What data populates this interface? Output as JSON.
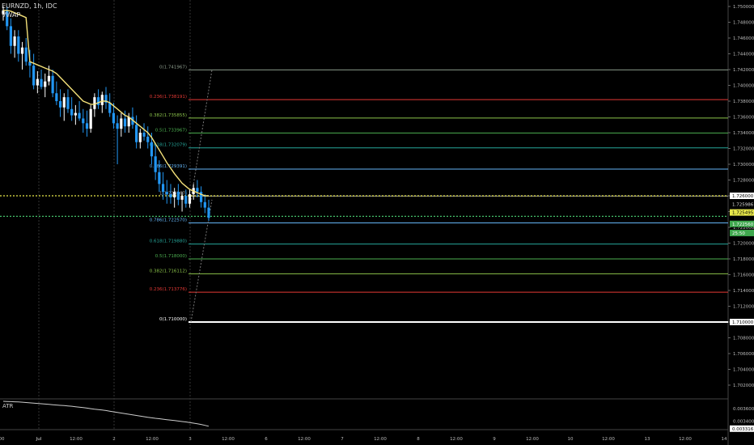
{
  "header": {
    "symbol": "EURNZD, 1h, IDC",
    "indicator": "VWAP"
  },
  "atr_label": "ATR",
  "colors": {
    "background": "#000000",
    "grid": "#2a2a2a",
    "candle_up": "#ffffff",
    "candle_down": "#2196f3",
    "vwap": "#f5e27a",
    "atr": "#cccccc",
    "price_dotted": "#e8e84a",
    "green_dotted": "#44c06a"
  },
  "price_axis": {
    "ticks": [
      "1.750000",
      "1.748000",
      "1.746000",
      "1.744000",
      "1.742000",
      "1.740000",
      "1.738000",
      "1.736000",
      "1.734000",
      "1.732000",
      "1.730000",
      "1.728000",
      "1.726000",
      "1.724000",
      "1.722000",
      "1.720000",
      "1.718000",
      "1.716000",
      "1.714000",
      "1.712000",
      "1.710000",
      "1.708000",
      "1.706000",
      "1.704000",
      "1.702000"
    ],
    "highlight_labels": [
      {
        "text": "1.726000",
        "kind": "white"
      },
      {
        "text": "1.725986",
        "kind": "black"
      },
      {
        "text": "1.725495",
        "kind": "yellow"
      },
      {
        "text": "1.722560",
        "kind": "green"
      },
      {
        "text": "25:50",
        "kind": "green"
      },
      {
        "text": "1.710000",
        "kind": "white"
      }
    ]
  },
  "atr_axis": {
    "ticks": [
      "0.003600",
      "0.003400"
    ],
    "current": "0.003316"
  },
  "time_axis": [
    "00",
    "Jul",
    "12:00",
    "2",
    "12:00",
    "3",
    "12:00",
    "6",
    "12:00",
    "7",
    "12:00",
    "8",
    "12:00",
    "9",
    "12:00",
    "10",
    "12:00",
    "13",
    "12:00",
    "14"
  ],
  "fib_upper": [
    {
      "label": "0(1.741967)",
      "price": 1.741967,
      "color": "#8a9a8a"
    },
    {
      "label": "0.236(1.738191)",
      "price": 1.738191,
      "color": "#e53935"
    },
    {
      "label": "0.382(1.735855)",
      "price": 1.735855,
      "color": "#8bc34a"
    },
    {
      "label": "0.5(1.733967)",
      "price": 1.733967,
      "color": "#4caf50"
    },
    {
      "label": "0.618(1.732079)",
      "price": 1.732079,
      "color": "#26a69a"
    },
    {
      "label": "0.786(1.729391)",
      "price": 1.729391,
      "color": "#64b5f6"
    },
    {
      "label": "1(1.725967)",
      "price": 1.725967,
      "color": "#9e9e9e"
    }
  ],
  "fib_lower": [
    {
      "label": "0.786(1.722570)",
      "price": 1.72257,
      "color": "#64b5f6"
    },
    {
      "label": "0.618(1.719880)",
      "price": 1.71988,
      "color": "#26a69a"
    },
    {
      "label": "0.5(1.718000)",
      "price": 1.718,
      "color": "#4caf50"
    },
    {
      "label": "0.382(1.716112)",
      "price": 1.716112,
      "color": "#8bc34a"
    },
    {
      "label": "0.236(1.713776)",
      "price": 1.713776,
      "color": "#e53935"
    },
    {
      "label": "0(1.710000)",
      "price": 1.71,
      "color": "#ffffff"
    }
  ],
  "candles": [
    [
      1.749,
      1.75,
      1.7482,
      1.7495
    ],
    [
      1.7495,
      1.75,
      1.747,
      1.7475
    ],
    [
      1.7475,
      1.7485,
      1.744,
      1.745
    ],
    [
      1.745,
      1.747,
      1.7435,
      1.7462
    ],
    [
      1.7462,
      1.747,
      1.743,
      1.744
    ],
    [
      1.744,
      1.7455,
      1.742,
      1.7448
    ],
    [
      1.7448,
      1.746,
      1.7425,
      1.743
    ],
    [
      1.743,
      1.7445,
      1.741,
      1.7425
    ],
    [
      1.7425,
      1.744,
      1.7395,
      1.74
    ],
    [
      1.74,
      1.7418,
      1.739,
      1.7408
    ],
    [
      1.7408,
      1.742,
      1.7395,
      1.7398
    ],
    [
      1.7398,
      1.7415,
      1.7385,
      1.7405
    ],
    [
      1.7405,
      1.7425,
      1.74,
      1.7412
    ],
    [
      1.7412,
      1.742,
      1.7385,
      1.739
    ],
    [
      1.739,
      1.7405,
      1.7375,
      1.738
    ],
    [
      1.738,
      1.7395,
      1.736,
      1.7372
    ],
    [
      1.7372,
      1.739,
      1.7355,
      1.7385
    ],
    [
      1.7385,
      1.7395,
      1.7365,
      1.737
    ],
    [
      1.737,
      1.7385,
      1.7355,
      1.7362
    ],
    [
      1.7362,
      1.7375,
      1.735,
      1.7365
    ],
    [
      1.7365,
      1.738,
      1.7355,
      1.7358
    ],
    [
      1.7358,
      1.737,
      1.734,
      1.7352
    ],
    [
      1.7352,
      1.7368,
      1.7335,
      1.7345
    ],
    [
      1.7345,
      1.7375,
      1.734,
      1.737
    ],
    [
      1.737,
      1.739,
      1.736,
      1.7385
    ],
    [
      1.7385,
      1.7395,
      1.737,
      1.7375
    ],
    [
      1.7375,
      1.7392,
      1.7365,
      1.7388
    ],
    [
      1.7388,
      1.7398,
      1.737,
      1.7378
    ],
    [
      1.7378,
      1.739,
      1.736,
      1.7365
    ],
    [
      1.7365,
      1.7378,
      1.7345,
      1.7352
    ],
    [
      1.7352,
      1.7362,
      1.73,
      1.7345
    ],
    [
      1.7345,
      1.7365,
      1.7335,
      1.7358
    ],
    [
      1.7358,
      1.7368,
      1.734,
      1.7348
    ],
    [
      1.7348,
      1.7365,
      1.734,
      1.736
    ],
    [
      1.736,
      1.7372,
      1.7345,
      1.735
    ],
    [
      1.735,
      1.7362,
      1.732,
      1.7328
    ],
    [
      1.7328,
      1.7345,
      1.732,
      1.734
    ],
    [
      1.734,
      1.7352,
      1.733,
      1.7335
    ],
    [
      1.7335,
      1.7348,
      1.732,
      1.7328
    ],
    [
      1.7328,
      1.734,
      1.73,
      1.731
    ],
    [
      1.731,
      1.7325,
      1.728,
      1.729
    ],
    [
      1.729,
      1.7305,
      1.7265,
      1.7275
    ],
    [
      1.7275,
      1.729,
      1.7255,
      1.7265
    ],
    [
      1.7265,
      1.728,
      1.725,
      1.7262
    ],
    [
      1.7262,
      1.7275,
      1.725,
      1.7258
    ],
    [
      1.7258,
      1.727,
      1.7245,
      1.7265
    ],
    [
      1.7265,
      1.7275,
      1.7248,
      1.7255
    ],
    [
      1.7255,
      1.7265,
      1.724,
      1.726
    ],
    [
      1.726,
      1.7268,
      1.7245,
      1.725
    ],
    [
      1.725,
      1.7268,
      1.7245,
      1.7262
    ],
    [
      1.7262,
      1.7275,
      1.7255,
      1.727
    ],
    [
      1.727,
      1.728,
      1.7258,
      1.7265
    ],
    [
      1.7265,
      1.7272,
      1.7245,
      1.7252
    ],
    [
      1.7252,
      1.7262,
      1.7238,
      1.7245
    ],
    [
      1.7245,
      1.7255,
      1.7228,
      1.7232
    ]
  ],
  "vwap": [
    1.7495,
    1.7495,
    1.7494,
    1.7492,
    1.749,
    1.7488,
    1.7486,
    1.743,
    1.7428,
    1.7426,
    1.7424,
    1.7422,
    1.742,
    1.7418,
    1.7415,
    1.741,
    1.7405,
    1.74,
    1.7395,
    1.739,
    1.7385,
    1.738,
    1.7378,
    1.7376,
    1.7376,
    1.7378,
    1.738,
    1.738,
    1.7378,
    1.7374,
    1.737,
    1.7366,
    1.7362,
    1.736,
    1.7356,
    1.7352,
    1.7348,
    1.7344,
    1.734,
    1.7334,
    1.7326,
    1.7318,
    1.731,
    1.7302,
    1.7295,
    1.7288,
    1.7282,
    1.7276,
    1.7272,
    1.7268,
    1.7266,
    1.7264,
    1.7262,
    1.726,
    1.726
  ],
  "atr_series": [
    0.00372,
    0.003718,
    0.003715,
    0.003712,
    0.00371,
    0.003706,
    0.0037,
    0.003695,
    0.00369,
    0.003686,
    0.00368,
    0.003675,
    0.00367,
    0.003665,
    0.00366,
    0.003655,
    0.00365,
    0.003645,
    0.00364,
    0.003632,
    0.003625,
    0.003618,
    0.00361,
    0.0036,
    0.003592,
    0.003585,
    0.003578,
    0.00357,
    0.00356,
    0.00355,
    0.00354,
    0.00353,
    0.00352,
    0.00351,
    0.0035,
    0.00349,
    0.00348,
    0.00347,
    0.00346,
    0.003452,
    0.003445,
    0.003438,
    0.00343,
    0.003422,
    0.003415,
    0.003408,
    0.0034,
    0.003392,
    0.003385,
    0.003375,
    0.003365,
    0.003355,
    0.003345,
    0.00333,
    0.003316
  ]
}
